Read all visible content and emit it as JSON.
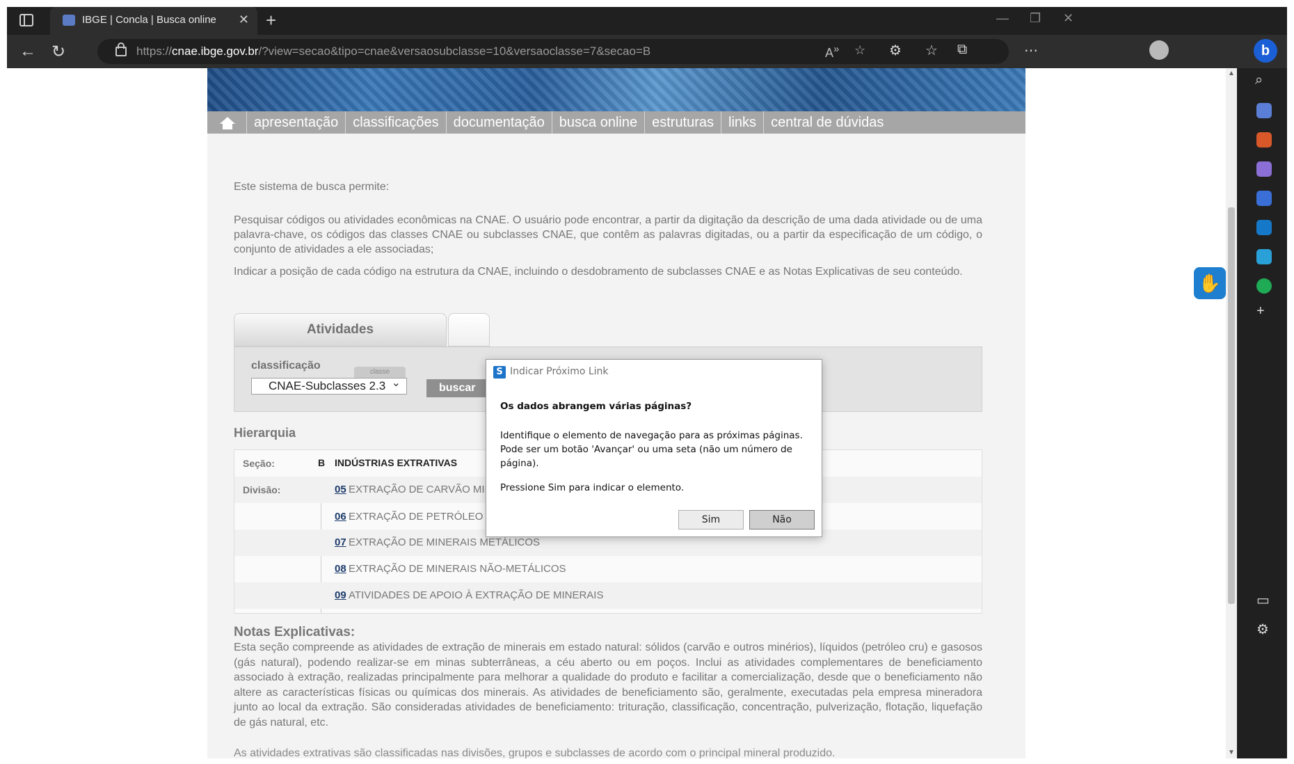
{
  "browser": {
    "tab_title": "IBGE | Concla | Busca online",
    "url_prefix": "https://",
    "url_domain": "cnae.ibge.gov.br",
    "url_path": "/?view=secao&tipo=cnae&versaosubclasse=10&versaoclasse=7&secao=B"
  },
  "menu": {
    "items": [
      "apresentação",
      "classificações",
      "documentação",
      "busca online",
      "estruturas",
      "links",
      "central de dúvidas"
    ]
  },
  "intro": {
    "line": "Este sistema de busca permite:",
    "para1": "Pesquisar códigos ou atividades econômicas na CNAE. O usuário pode encontrar, a partir da digitação da descrição de uma dada atividade ou de uma palavra-chave, os códigos das classes CNAE ou subclasses CNAE, que contêm as palavras digitadas, ou a partir da especificação de um código, o conjunto de atividades a ele associadas;",
    "para2": "Indicar a posição de cada código na estrutura da CNAE, incluindo o desdobramento de subclasses CNAE e as Notas Explicativas de seu conteúdo."
  },
  "search": {
    "tab_activities": "Atividades",
    "classification_label": "classificação",
    "tag": "classe",
    "selected": "CNAE-Subclasses 2.3",
    "button": "buscar"
  },
  "hierarchy": {
    "title": "Hierarquia",
    "section_label": "Seção:",
    "section_code": "B",
    "section_name": "INDÚSTRIAS EXTRATIVAS",
    "division_label": "Divisão:",
    "divisions": [
      {
        "code": "05",
        "name": "EXTRAÇÃO DE CARVÃO MINERAL"
      },
      {
        "code": "06",
        "name": "EXTRAÇÃO DE PETRÓLEO E GÁS NATURAL"
      },
      {
        "code": "07",
        "name": "EXTRAÇÃO DE MINERAIS METÁLICOS"
      },
      {
        "code": "08",
        "name": "EXTRAÇÃO DE MINERAIS NÃO-METÁLICOS"
      },
      {
        "code": "09",
        "name": "ATIVIDADES DE APOIO À EXTRAÇÃO DE MINERAIS"
      }
    ]
  },
  "notes": {
    "title": "Notas Explicativas:",
    "text": "Esta seção compreende as atividades de extração de minerais em estado natural: sólidos (carvão e outros minérios), líquidos (petróleo cru) e gasosos (gás natural), podendo realizar-se em minas subterrâneas, a céu aberto ou em poços. Inclui as atividades complementares de beneficiamento associado à extração, realizadas principalmente para melhorar a qualidade do produto e facilitar a comercialização, desde que o beneficiamento não altere as características físicas ou químicas dos minerais. As atividades de beneficiamento são, geralmente, executadas pela empresa mineradora junto ao local da extração. São consideradas atividades de beneficiamento: trituração, classificação, concentração, pulverização, flotação, liquefação de gás natural, etc.",
    "cut_line": "As atividades extrativas são classificadas nas divisões, grupos e subclasses de acordo com o principal mineral produzido."
  },
  "dialog": {
    "title": "Indicar Próximo Link",
    "question": "Os dados abrangem várias páginas?",
    "body": "Identifique o elemento de navegação para as próximas páginas. Pode ser um botão 'Avançar' ou uma seta (não um número de página).",
    "press": "Pressione Sim para indicar o elemento.",
    "yes": "Sim",
    "no": "Não"
  },
  "colors": {
    "menu_bg": "#a6a6a6",
    "link": "#1c3b6b",
    "browser_dark": "#202020",
    "bing": "#1b5fd6"
  }
}
